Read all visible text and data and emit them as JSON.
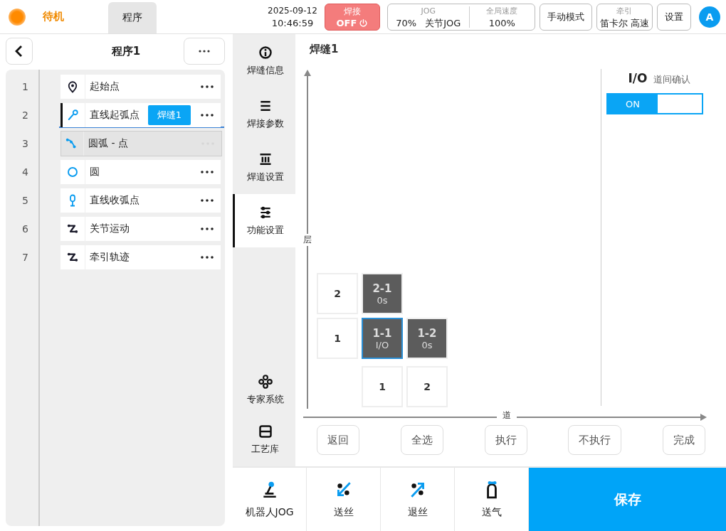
{
  "top_bar": {
    "status": "待机",
    "tabs": [
      {
        "label": "程序",
        "selected": true
      }
    ],
    "date": "2025-09-12",
    "time": "10:46:59",
    "weld": {
      "label": "焊接",
      "state": "OFF",
      "on": false
    },
    "jog": {
      "label": "JOG",
      "speed": "70%",
      "mode": "关节JOG"
    },
    "global_speed": {
      "label": "全局速度",
      "value": "100%"
    },
    "mode_button": "手动模式",
    "traction": {
      "label": "牵引",
      "value": "笛卡尔 高速"
    },
    "settings_button": "设置",
    "avatar": "A"
  },
  "program": {
    "title": "程序1",
    "items": [
      {
        "number": "1",
        "label": "起始点",
        "kind": "pin",
        "current": false,
        "selected": false
      },
      {
        "number": "2",
        "label": "直线起弧点",
        "kind": "arc-start",
        "tag": "焊缝1",
        "current": true,
        "selected": false
      },
      {
        "number": "3",
        "label": "圆弧 - 点",
        "kind": "arc",
        "current": false,
        "selected": true
      },
      {
        "number": "4",
        "label": "圆",
        "kind": "circle",
        "current": false,
        "selected": false
      },
      {
        "number": "5",
        "label": "直线收弧点",
        "kind": "arc-end",
        "current": false,
        "selected": false
      },
      {
        "number": "6",
        "label": "关节运动",
        "kind": "joint",
        "current": false,
        "selected": false
      },
      {
        "number": "7",
        "label": "牵引轨迹",
        "kind": "joint",
        "current": false,
        "selected": false
      }
    ]
  },
  "side_nav": [
    {
      "label": "焊缝信息",
      "kind": "info",
      "selected": false
    },
    {
      "label": "焊接参数",
      "kind": "list",
      "selected": false
    },
    {
      "label": "焊道设置",
      "kind": "columns",
      "selected": false
    },
    {
      "label": "功能设置",
      "kind": "sliders",
      "selected": true
    },
    {
      "label": "专家系统",
      "kind": "flower",
      "selected": false,
      "bottom": true
    },
    {
      "label": "工艺库",
      "kind": "library",
      "selected": false,
      "bottom": true
    }
  ],
  "panel": {
    "title": "焊缝1",
    "y_axis": "层",
    "x_axis": "道",
    "layers": [
      {
        "label": "2",
        "passes": [
          {
            "label": "2-1",
            "sub": "0s",
            "selected": false
          }
        ]
      },
      {
        "label": "1",
        "passes": [
          {
            "label": "1-1",
            "sub": "I/O",
            "selected": true
          },
          {
            "label": "1-2",
            "sub": "0s",
            "selected": false
          }
        ]
      }
    ],
    "pass_numbers": [
      "1",
      "2"
    ],
    "io_confirm": {
      "title": "I/O",
      "label": "道间确认",
      "toggle": "ON",
      "on": true
    },
    "buttons": [
      "返回",
      "全选",
      "执行",
      "不执行",
      "完成"
    ]
  },
  "bottom_bar": {
    "tools": [
      {
        "label": "机器人JOG",
        "kind": "joystick"
      },
      {
        "label": "送丝",
        "kind": "feed"
      },
      {
        "label": "退丝",
        "kind": "retract"
      },
      {
        "label": "送气",
        "kind": "gas"
      }
    ],
    "save": "保存"
  }
}
